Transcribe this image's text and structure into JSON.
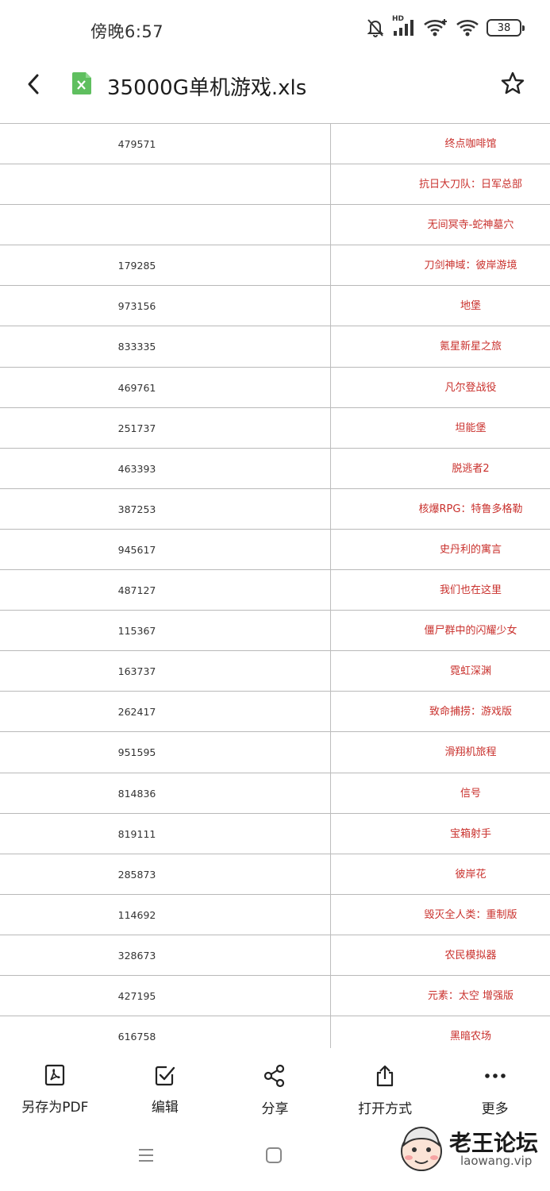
{
  "status": {
    "time": "傍晚6:57",
    "battery": "38",
    "network_label": "HD"
  },
  "header": {
    "title": "35000G单机游戏.xls",
    "icons": {
      "back": "back-arrow-icon",
      "file": "excel-file-icon",
      "favorite": "star-outline-icon"
    }
  },
  "sheet": {
    "rows": [
      {
        "id": "479571",
        "name": "终点咖啡馆"
      },
      {
        "id": "",
        "name": "抗日大刀队：日军总部"
      },
      {
        "id": "",
        "name": "无间冥寺-蛇神墓穴"
      },
      {
        "id": "179285",
        "name": "刀剑神域：彼岸游境"
      },
      {
        "id": "973156",
        "name": "地堡"
      },
      {
        "id": "833335",
        "name": "氪星新星之旅"
      },
      {
        "id": "469761",
        "name": "凡尔登战役"
      },
      {
        "id": "251737",
        "name": "坦能堡"
      },
      {
        "id": "463393",
        "name": "脱逃者2"
      },
      {
        "id": "387253",
        "name": "核爆RPG：特鲁多格勒"
      },
      {
        "id": "945617",
        "name": "史丹利的寓言"
      },
      {
        "id": "487127",
        "name": "我们也在这里"
      },
      {
        "id": "115367",
        "name": "僵尸群中的闪耀少女"
      },
      {
        "id": "163737",
        "name": "霓虹深渊"
      },
      {
        "id": "262417",
        "name": "致命捕捞：游戏版"
      },
      {
        "id": "951595",
        "name": "滑翔机旅程"
      },
      {
        "id": "814836",
        "name": "信号"
      },
      {
        "id": "819111",
        "name": "宝箱射手"
      },
      {
        "id": "285873",
        "name": "彼岸花"
      },
      {
        "id": "114692",
        "name": "毁灭全人类：重制版"
      },
      {
        "id": "328673",
        "name": "农民模拟器"
      },
      {
        "id": "427195",
        "name": "元素：太空 增强版"
      },
      {
        "id": "616758",
        "name": "黑暗农场"
      }
    ],
    "name_color": "#c9302c"
  },
  "actions": [
    {
      "label": "另存为PDF",
      "icon": "pdf-icon"
    },
    {
      "label": "编辑",
      "icon": "edit-checkbox-icon"
    },
    {
      "label": "分享",
      "icon": "share-icon"
    },
    {
      "label": "打开方式",
      "icon": "open-with-icon"
    },
    {
      "label": "更多",
      "icon": "more-dots-icon"
    }
  ],
  "watermark": {
    "title": "老王论坛",
    "url": "laowang.vip"
  },
  "colors": {
    "excel_green": "#4caf50",
    "text_red": "#c9302c"
  }
}
